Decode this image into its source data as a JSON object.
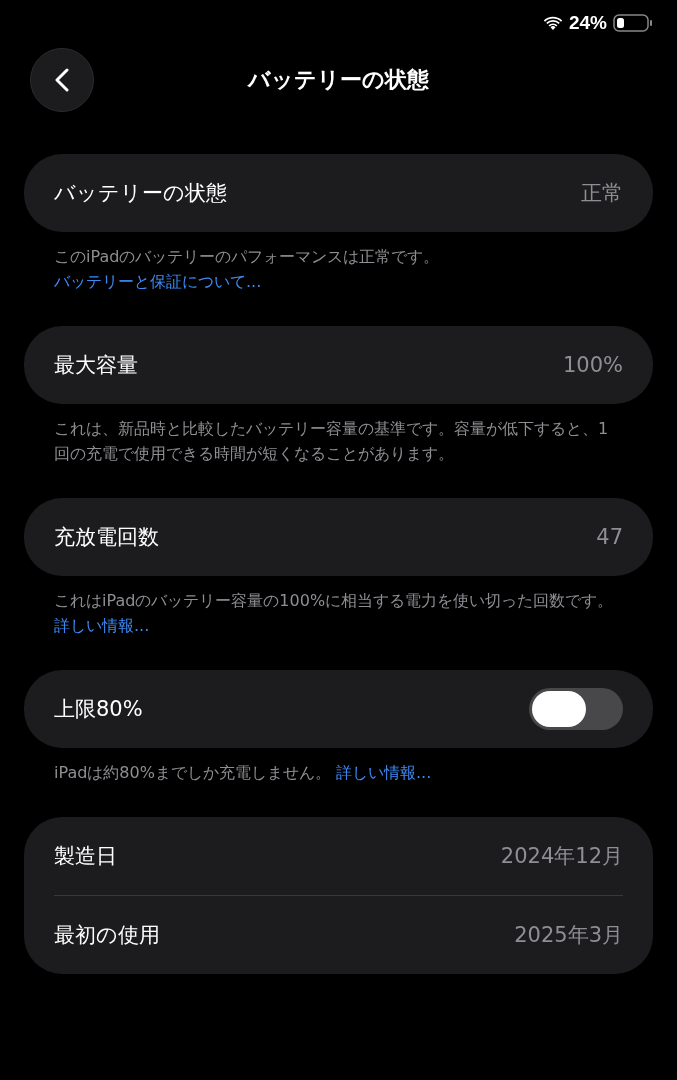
{
  "status_bar": {
    "battery_percent": "24%"
  },
  "nav": {
    "title": "バッテリーの状態"
  },
  "sections": [
    {
      "rows": [
        {
          "kind": "value",
          "label": "バッテリーの状態",
          "value": "正常"
        }
      ],
      "footer": {
        "text": "このiPadのバッテリーのパフォーマンスは正常です。",
        "link": "バッテリーと保証について..."
      }
    },
    {
      "rows": [
        {
          "kind": "value",
          "label": "最大容量",
          "value": "100%"
        }
      ],
      "footer": {
        "text": "これは、新品時と比較したバッテリー容量の基準です。容量が低下すると、1回の充電で使用できる時間が短くなることがあります。"
      }
    },
    {
      "rows": [
        {
          "kind": "value",
          "label": "充放電回数",
          "value": "47"
        }
      ],
      "footer": {
        "text": "これはiPadのバッテリー容量の100%に相当する電力を使い切った回数です。 ",
        "link": "詳しい情報..."
      }
    },
    {
      "rows": [
        {
          "kind": "toggle",
          "label": "上限80%",
          "on": false
        }
      ],
      "footer": {
        "text": "iPadは約80%までしか充電しません。 ",
        "link": "詳しい情報..."
      }
    },
    {
      "rows": [
        {
          "kind": "value",
          "label": "製造日",
          "value": "2024年12月"
        },
        {
          "kind": "value",
          "label": "最初の使用",
          "value": "2025年3月"
        }
      ]
    }
  ]
}
